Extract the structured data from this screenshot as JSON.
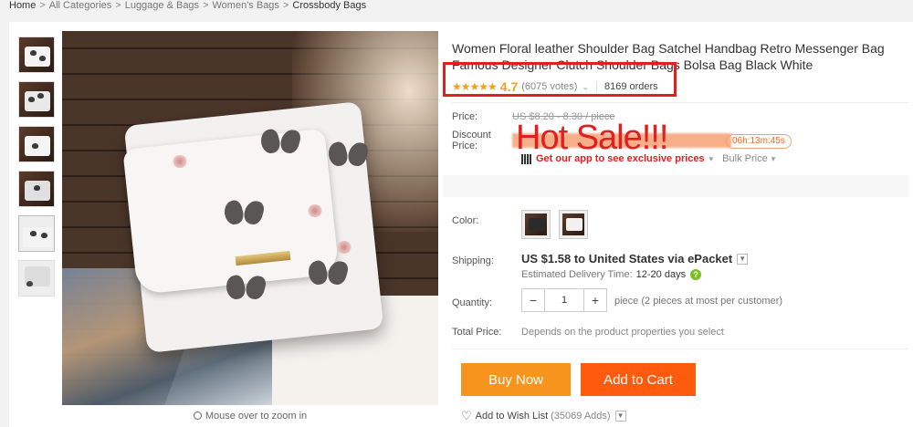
{
  "breadcrumb": [
    "Home",
    "All Categories",
    "Luggage & Bags",
    "Women's Bags",
    "Crossbody Bags"
  ],
  "breadcrumb_sep": ">",
  "product": {
    "title_line1": "Women Floral leather Shoulder Bag Satchel Handbag Retro Messenger Bag",
    "title_line2": "Famous Designer Clutch Shoulder Bags Bolsa Bag Black White",
    "stars": "★★★★★",
    "rating": "4.7",
    "votes": "(6075 votes)",
    "orders": "8169 orders"
  },
  "price": {
    "label": "Price:",
    "old": "US $8.20 - 8.30 / piece",
    "discount_label_1": "Discount",
    "discount_label_2": "Price:",
    "overlay": "Hot Sale!!!",
    "countdown": "06h:13m:45s",
    "app_text": "Get our app to see exclusive prices",
    "bulk": "Bulk Price"
  },
  "color": {
    "label": "Color:"
  },
  "shipping": {
    "label": "Shipping:",
    "main": "US $1.58 to United States via ePacket",
    "est_label": "Estimated Delivery Time:",
    "est_days": "12-20 days"
  },
  "quantity": {
    "label": "Quantity:",
    "minus": "−",
    "value": "1",
    "plus": "+",
    "note": "piece (2 pieces at most per customer)"
  },
  "total": {
    "label": "Total Price:",
    "note": "Depends on the product properties you select"
  },
  "actions": {
    "buy_now": "Buy Now",
    "add_to_cart": "Add to Cart",
    "wish_label": "Add to Wish List",
    "wish_count": "(35069 Adds)"
  },
  "zoom_hint": "Mouse over to zoom in",
  "colors": {
    "accent_red": "#e02020",
    "buy_now": "#f7941d",
    "add_to_cart": "#ff5b0f",
    "star": "#f0a020"
  }
}
